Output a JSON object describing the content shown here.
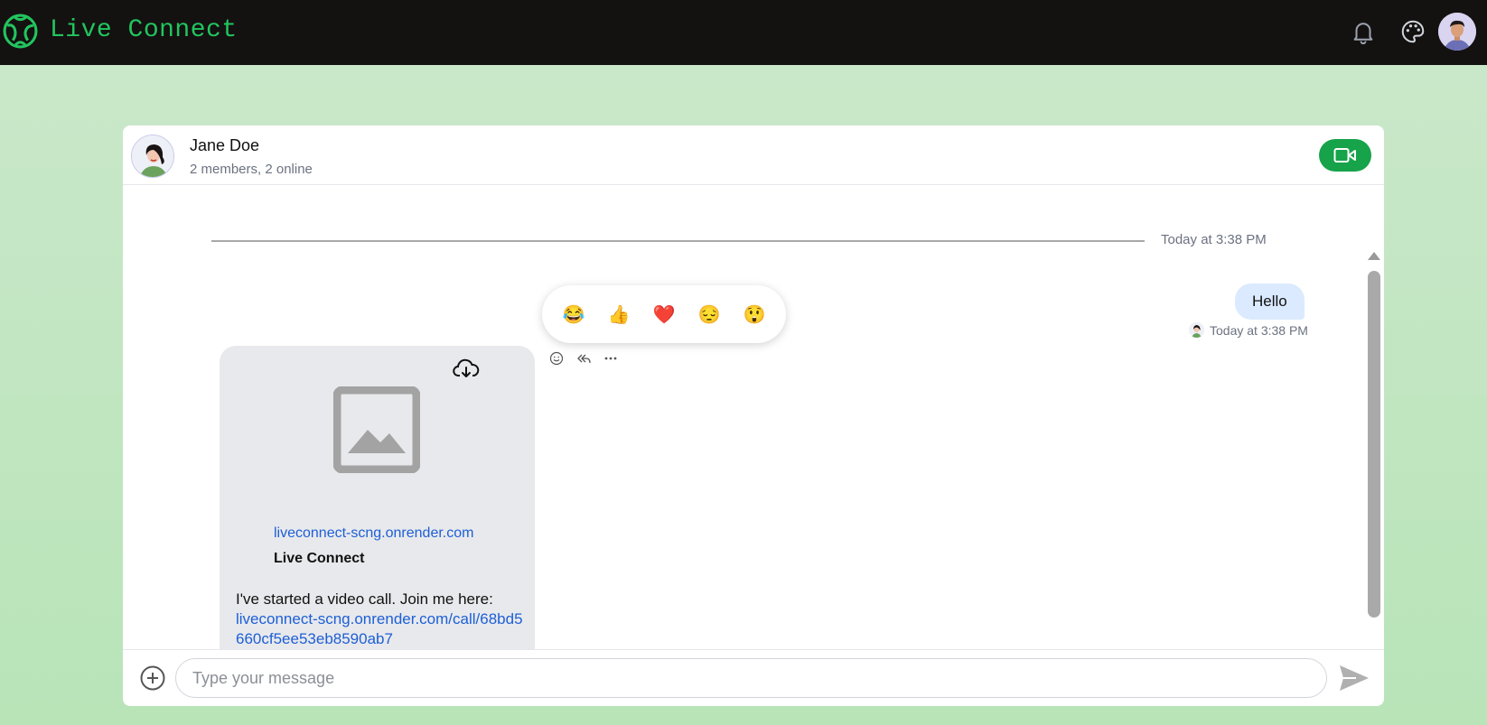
{
  "app": {
    "title": "Live Connect"
  },
  "header": {
    "icons": [
      "bell-icon",
      "palette-icon"
    ],
    "accent": "#22c55e",
    "bar_color": "#141111"
  },
  "chat": {
    "name": "Jane Doe",
    "subtitle": "2 members, 2 online",
    "video_button_color": "#16a34a"
  },
  "messages": {
    "date_separator": "Today at 3:38 PM",
    "outgoing": {
      "text": "Hello",
      "time": "Today at 3:38 PM"
    },
    "reactions": [
      "😂",
      "👍",
      "❤️",
      "😔",
      "😲"
    ],
    "actions": [
      "smile-icon",
      "reply-icon",
      "more-icon"
    ],
    "link_card": {
      "domain": "liveconnect-scng.onrender.com",
      "title": "Live Connect",
      "text": "I've started a video call. Join me here:",
      "link": "liveconnect-scng.onrender.com/call/68bd5660cf5ee53eb8590ab7"
    }
  },
  "composer": {
    "placeholder": "Type your message"
  }
}
